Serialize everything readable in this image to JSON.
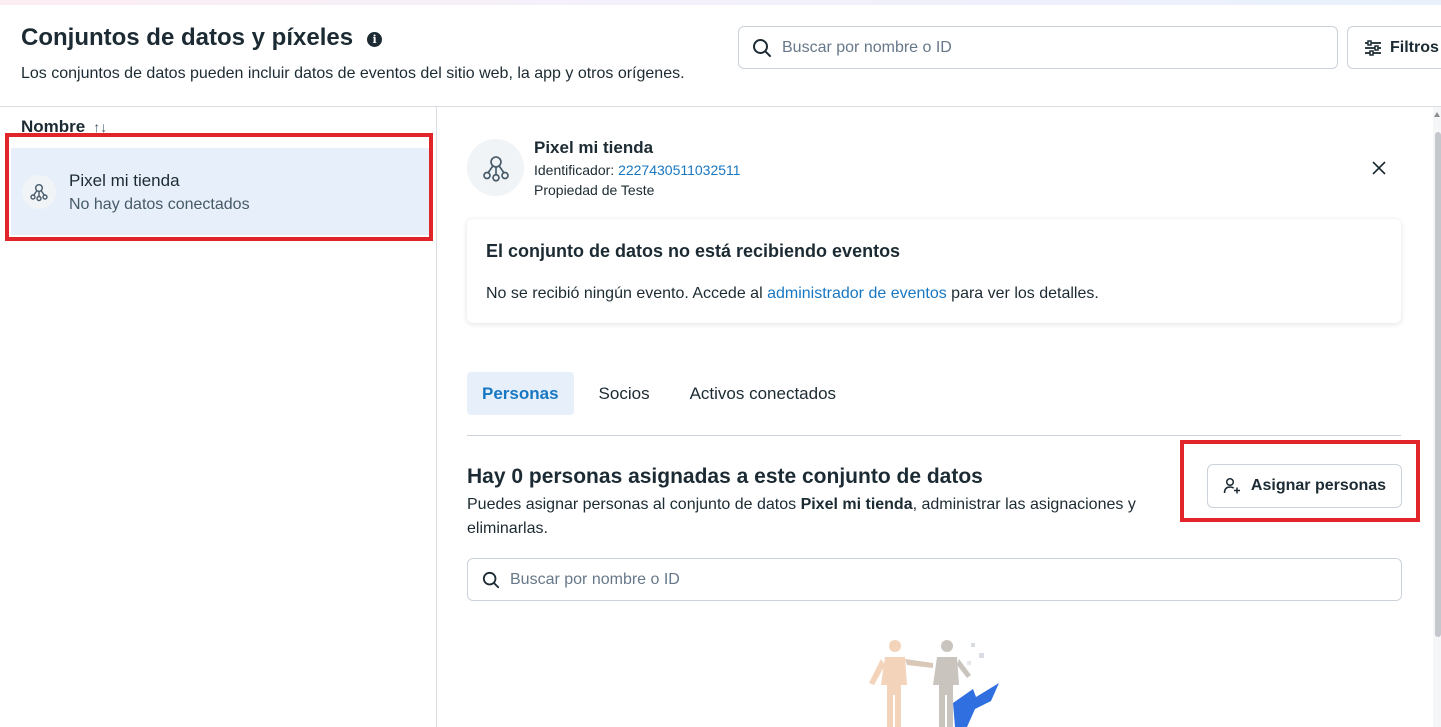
{
  "header": {
    "title": "Conjuntos de datos y píxeles",
    "subtitle": "Los conjuntos de datos pueden incluir datos de eventos del sitio web, la app y otros orígenes.",
    "search_placeholder": "Buscar por nombre o ID",
    "filters_label": "Filtros"
  },
  "list": {
    "column_header": "Nombre",
    "sort_glyph": "↑↓",
    "items": [
      {
        "name": "Pixel mi tienda",
        "status": "No hay datos conectados"
      }
    ]
  },
  "detail": {
    "name": "Pixel mi tienda",
    "id_label": "Identificador: ",
    "id_value": "2227430511032511",
    "property": "Propiedad de Teste",
    "alert": {
      "title": "El conjunto de datos no está recibiendo eventos",
      "body_before": "No se recibió ningún evento. Accede al ",
      "body_link": "administrador de eventos",
      "body_after": " para ver los detalles."
    },
    "tabs": [
      {
        "label": "Personas",
        "active": true
      },
      {
        "label": "Socios",
        "active": false
      },
      {
        "label": "Activos conectados",
        "active": false
      }
    ],
    "assign": {
      "title": "Hay 0 personas asignadas a este conjunto de datos",
      "desc_before": "Puedes asignar personas al conjunto de datos ",
      "desc_bold": "Pixel mi tienda",
      "desc_after": ", administrar las asignaciones y eliminarlas.",
      "button_label": "Asignar personas"
    },
    "search_placeholder": "Buscar por nombre o ID"
  },
  "colors": {
    "accent": "#1877c2",
    "selected_bg": "#e7f0fa",
    "highlight_red": "#e0242a",
    "text": "#1c2b33"
  },
  "icons": {
    "info": "info-icon",
    "search": "search-icon",
    "filters": "sliders-icon",
    "dataset": "dataset-network-icon",
    "close": "close-icon",
    "add_person": "add-person-icon"
  }
}
